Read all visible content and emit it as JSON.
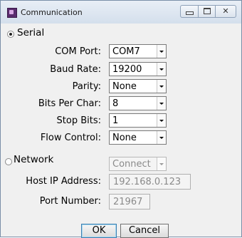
{
  "window": {
    "title": "Communication",
    "controls": {
      "minimize": "minimize-icon",
      "maximize": "maximize-icon",
      "close": "close-icon"
    },
    "close_glyph": "✕"
  },
  "serial": {
    "label": "Serial",
    "selected": true,
    "fields": [
      {
        "label": "COM Port:",
        "value": "COM7"
      },
      {
        "label": "Baud Rate:",
        "value": "19200"
      },
      {
        "label": "Parity:",
        "value": "None"
      },
      {
        "label": "Bits Per Char:",
        "value": "8"
      },
      {
        "label": "Stop Bits:",
        "value": "1"
      },
      {
        "label": "Flow Control:",
        "value": "None"
      }
    ]
  },
  "network": {
    "label": "Network",
    "selected": false,
    "connect_value": "Connect",
    "host_ip": {
      "label": "Host IP Address:",
      "value": "192.168.0.123"
    },
    "port": {
      "label": "Port Number:",
      "value": "21967"
    }
  },
  "buttons": {
    "ok": "OK",
    "cancel": "Cancel"
  }
}
